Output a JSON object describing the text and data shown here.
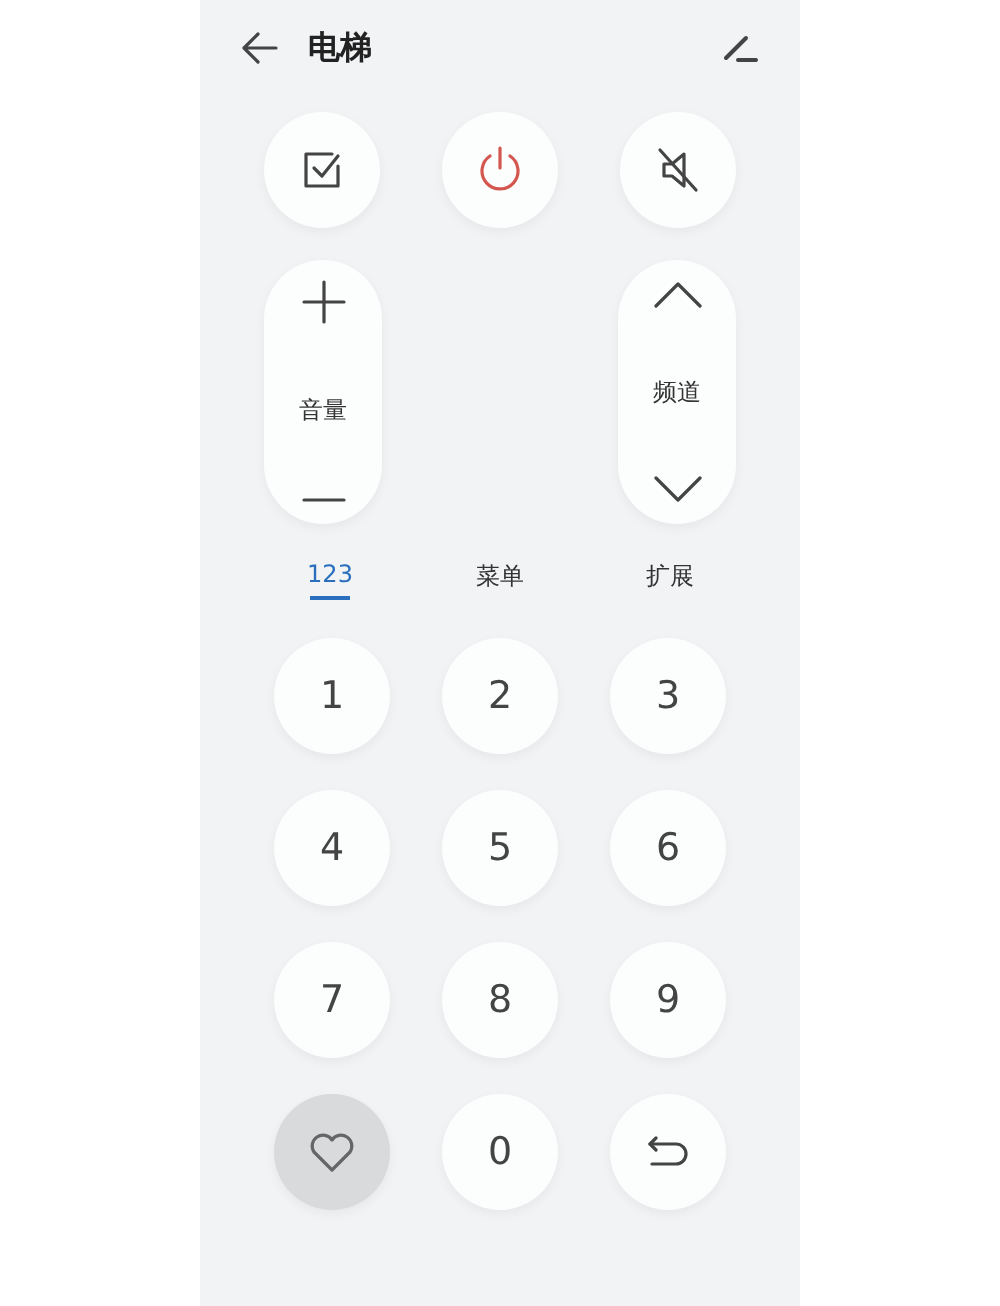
{
  "header": {
    "title": "电梯"
  },
  "top_buttons": [
    {
      "kind": "check"
    },
    {
      "kind": "power"
    },
    {
      "kind": "mute"
    }
  ],
  "rockers": [
    {
      "kind": "volume",
      "label": "音量"
    },
    {
      "kind": "channel",
      "label": "频道"
    }
  ],
  "tabs": [
    {
      "label": "123",
      "selected": true
    },
    {
      "label": "菜单",
      "selected": false
    },
    {
      "label": "扩展",
      "selected": false
    }
  ],
  "keypad": [
    {
      "kind": "digit",
      "label": "1"
    },
    {
      "kind": "digit",
      "label": "2"
    },
    {
      "kind": "digit",
      "label": "3"
    },
    {
      "kind": "digit",
      "label": "4"
    },
    {
      "kind": "digit",
      "label": "5"
    },
    {
      "kind": "digit",
      "label": "6"
    },
    {
      "kind": "digit",
      "label": "7"
    },
    {
      "kind": "digit",
      "label": "8"
    },
    {
      "kind": "digit",
      "label": "9"
    },
    {
      "kind": "favorite",
      "highlighted": true
    },
    {
      "kind": "digit",
      "label": "0"
    },
    {
      "kind": "return",
      "highlighted": false
    }
  ]
}
